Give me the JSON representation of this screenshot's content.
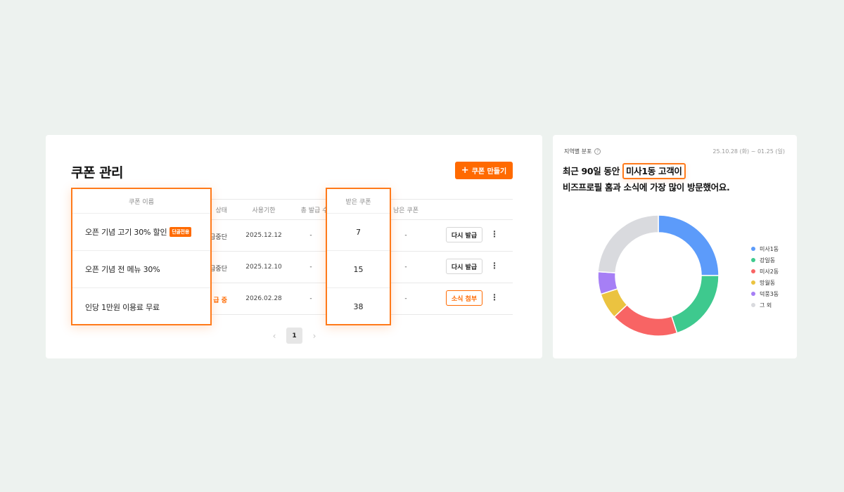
{
  "coupon_card": {
    "title": "쿠폰 관리",
    "create_button": "쿠폰 만들기",
    "columns": {
      "name": "쿠폰 이름",
      "status": "상태",
      "expiry": "사용기한",
      "total_issued": "총 발급 수",
      "received": "받은 쿠폰",
      "remaining": "남은 쿠폰"
    },
    "rows": [
      {
        "name": "오픈 기념 고기 30% 할인",
        "badge": "단골전용",
        "status_visible": "급중단",
        "expiry": "2025.12.12",
        "total_issued": "-",
        "received": "7",
        "remaining": "-",
        "action": "다시 발급"
      },
      {
        "name": "오픈 기념 전 메뉴 30%",
        "status_visible": "급중단",
        "expiry": "2025.12.10",
        "total_issued": "-",
        "received": "15",
        "remaining": "-",
        "action": "다시 발급"
      },
      {
        "name": "인당 1만원 이용료 무료",
        "status_visible": "급 중",
        "expiry": "2026.02.28",
        "total_issued": "-",
        "received": "38",
        "remaining": "-",
        "action": "소식 첨부"
      }
    ],
    "pagination": {
      "current": "1"
    }
  },
  "region_card": {
    "label": "지역별 분포",
    "date_range": "25.10.28 (화) ~ 01.25 (일)",
    "headline": {
      "prefix": "최근 90일 동안 ",
      "highlight": "미사1동 고객이",
      "line2": "비즈프로필 홈과 소식에 가장 많이 방문했어요."
    }
  },
  "chart_data": {
    "type": "pie",
    "donut": true,
    "series": [
      {
        "name": "미사1동",
        "value": 25,
        "color": "#5c9bfa"
      },
      {
        "name": "강일동",
        "value": 20,
        "color": "#3ec98e"
      },
      {
        "name": "미사2동",
        "value": 18,
        "color": "#f86464"
      },
      {
        "name": "망월동",
        "value": 7,
        "color": "#ebc340"
      },
      {
        "name": "덕풍3동",
        "value": 6,
        "color": "#a67ff5"
      },
      {
        "name": "그 외",
        "value": 24,
        "color": "#d9dade"
      }
    ],
    "legend": "right"
  }
}
